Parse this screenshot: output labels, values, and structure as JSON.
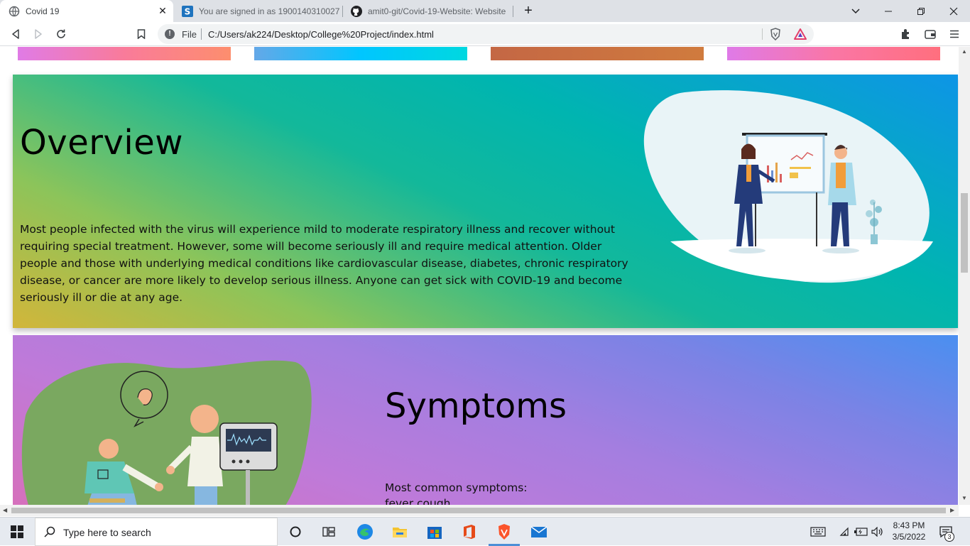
{
  "browser": {
    "tabs": [
      {
        "title": "Covid 19",
        "icon": "globe-icon",
        "active": true
      },
      {
        "title": "You are signed in as 1900140310027",
        "icon": "s-logo-icon",
        "active": false
      },
      {
        "title": "amit0-git/Covid-19-Website: Website",
        "icon": "github-icon",
        "active": false
      }
    ],
    "omnibox": {
      "scheme_label": "File",
      "url": "C:/Users/ak224/Desktop/College%20Project/index.html"
    }
  },
  "page": {
    "overview": {
      "heading": "Overview",
      "body": "Most people infected with the virus will experience mild to moderate respiratory illness and recover without requiring special treatment. However, some will become seriously ill and require medical attention. Older people and those with underlying medical conditions like cardiovascular disease, diabetes, chronic respiratory disease, or cancer are more likely to develop serious illness. Anyone can get sick with COVID-19 and become seriously ill or die at any age."
    },
    "symptoms": {
      "heading": "Symptoms",
      "lead": "Most common symptoms:",
      "next_line": "fever cough"
    }
  },
  "taskbar": {
    "search_placeholder": "Type here to search",
    "time": "8:43 PM",
    "date": "3/5/2022",
    "notification_count": "3"
  },
  "colors": {
    "overview_gradient": [
      "#d2b63a",
      "#8cc45a",
      "#13b89a",
      "#0e95e6"
    ],
    "symptoms_gradient": [
      "#d86fb9",
      "#a47ee0",
      "#4a8ff0"
    ],
    "illustration_green": "#7aa860"
  }
}
